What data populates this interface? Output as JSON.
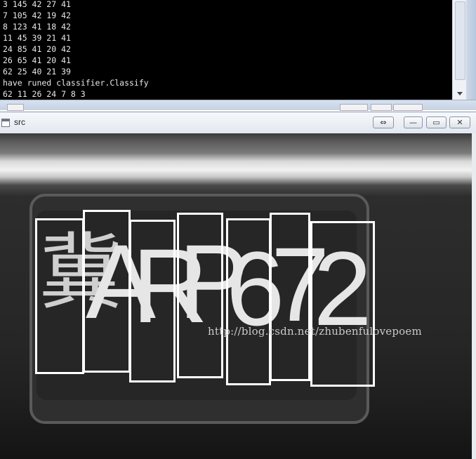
{
  "console": {
    "lines": [
      "3 145 42 27 41",
      "7 105 42 19 42",
      "8 123 41 18 42",
      "11 45 39 21 41",
      "24 85 41 20 42",
      "26 65 41 20 41",
      "62 25 40 21 39",
      "have runed classifier.Classify",
      "62 11 26 24 7 8 3"
    ]
  },
  "window": {
    "title": "src",
    "buttons": {
      "extra": "⇔",
      "minimize": "—",
      "maximize": "▭",
      "close": "✕"
    }
  },
  "plate": {
    "characters": [
      "冀",
      "A",
      "R",
      "P",
      "6",
      "7",
      "2"
    ]
  },
  "watermark": "http://blog.csdn.net/zhubenfulovepoem"
}
